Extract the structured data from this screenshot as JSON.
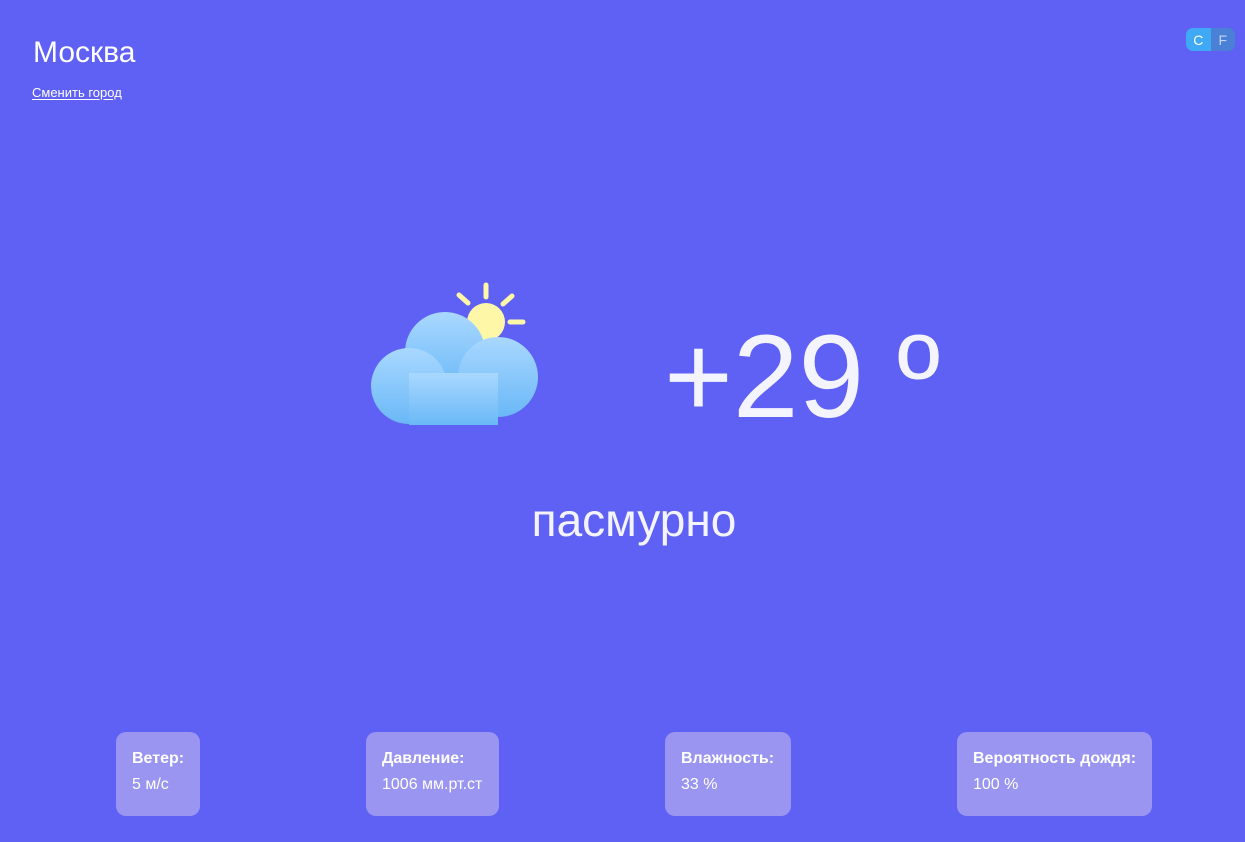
{
  "header": {
    "city": "Москва",
    "change_city_label": "Сменить город"
  },
  "units": {
    "celsius_label": "C",
    "fahrenheit_label": "F",
    "selected": "C"
  },
  "current": {
    "icon": "partly-cloudy-icon",
    "temperature": "+29 º",
    "condition": "пасмурно"
  },
  "details": [
    {
      "label": "Ветер:",
      "value": "5 м/с"
    },
    {
      "label": "Давление:",
      "value": "1006 мм.рт.ст"
    },
    {
      "label": "Влажность:",
      "value": "33 %"
    },
    {
      "label": "Вероятность дождя:",
      "value": "100 %"
    }
  ],
  "colors": {
    "background": "#5f60f4",
    "card": "#9a95e6",
    "toggle_active": "#3fa9f5",
    "toggle_inactive": "#4a80d6",
    "sun": "#fff7a8",
    "cloud_top": "#a9d8ff",
    "cloud_bottom": "#6ab8f7"
  }
}
